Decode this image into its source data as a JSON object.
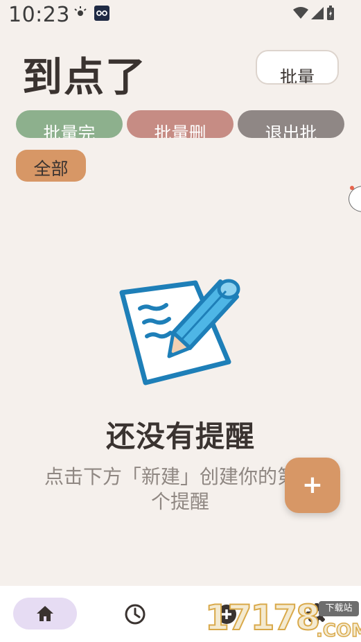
{
  "status_bar": {
    "time": "10:23",
    "icons": [
      "brightness-icon",
      "app-badge-icon",
      "wifi-icon",
      "signal-icon",
      "battery-icon"
    ]
  },
  "header": {
    "title": "到点了",
    "batch_label": "批量"
  },
  "filters": {
    "batch_done": "批量完",
    "batch_delete": "批量删",
    "exit_batch": "退出批",
    "all": "全部"
  },
  "empty_state": {
    "title": "还没有提醒",
    "description": "点击下方「新建」创建你的第一个提醒"
  },
  "fab": {
    "label": "+"
  },
  "bottom_nav": {
    "items": [
      "home-icon",
      "clock-icon",
      "add-icon",
      "settings-icon"
    ]
  },
  "watermark": {
    "digits": "17178",
    "tag": "下载站",
    "domain": ".COM"
  },
  "colors": {
    "background": "#f5f0ec",
    "accent": "#d79766",
    "done": "#8db08d",
    "delete": "#c68c84",
    "exit": "#8f8785",
    "nav_selected": "#e6dcf3",
    "illustration_blue": "#1e7fb8"
  }
}
